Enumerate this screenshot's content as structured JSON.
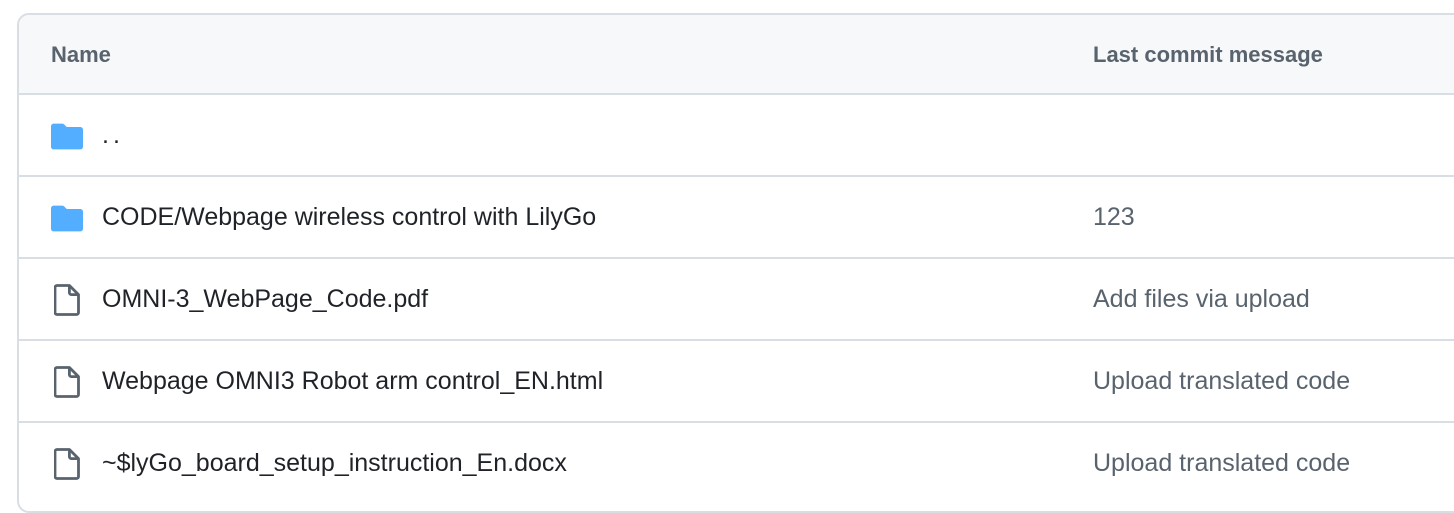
{
  "header": {
    "name_label": "Name",
    "message_label": "Last commit message"
  },
  "rows": [
    {
      "type": "folder",
      "name": "..",
      "message": ""
    },
    {
      "type": "folder",
      "name": "CODE/Webpage wireless control with LilyGo",
      "message": "123"
    },
    {
      "type": "file",
      "name": "OMNI-3_WebPage_Code.pdf",
      "message": "Add files via upload"
    },
    {
      "type": "file",
      "name": "Webpage OMNI3 Robot arm control_EN.html",
      "message": "Upload translated code"
    },
    {
      "type": "file",
      "name": "~$lyGo_board_setup_instruction_En.docx",
      "message": "Upload translated code"
    }
  ],
  "colors": {
    "folder_icon": "#54aeff",
    "file_icon": "#59636e",
    "border": "#d8dee4",
    "header_bg": "#f6f8fa"
  },
  "icons": {
    "folder": "folder-icon",
    "file": "file-icon"
  }
}
